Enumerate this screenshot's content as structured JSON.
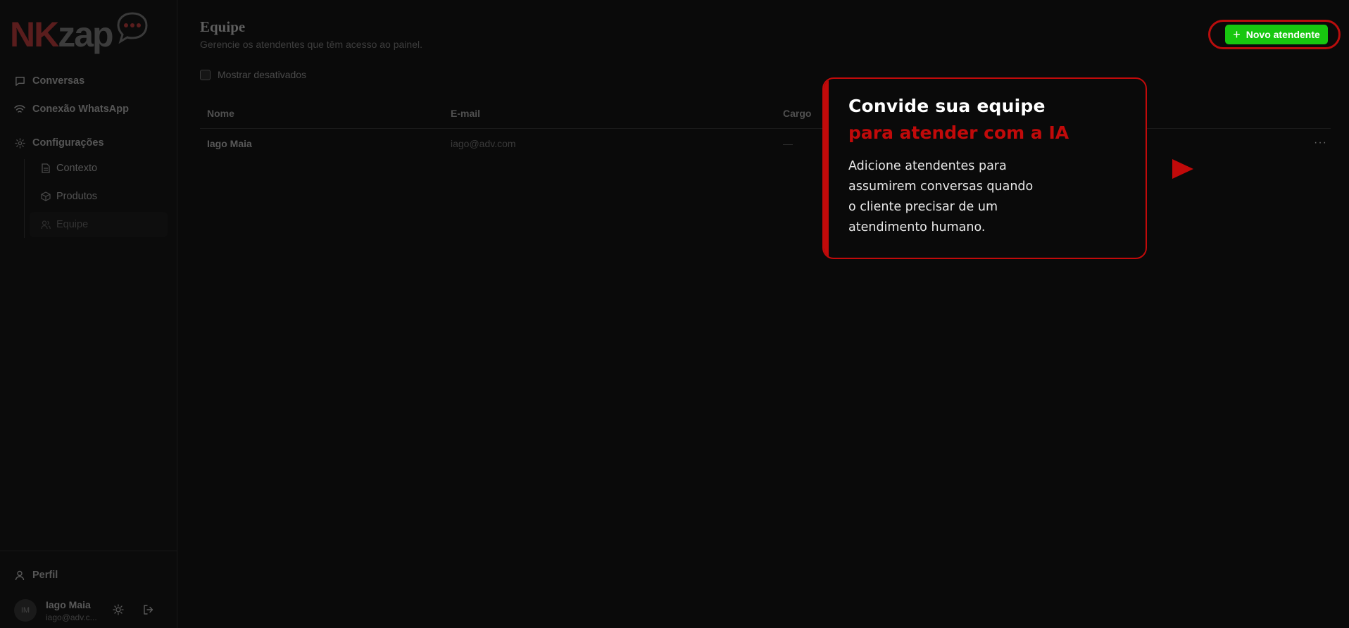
{
  "brand": {
    "prefix": "NK",
    "suffix": "zap"
  },
  "sidebar": {
    "items": [
      {
        "label": "Conversas",
        "icon": "chat-bubble-icon"
      },
      {
        "label": "Conexão WhatsApp",
        "icon": "wifi-icon"
      },
      {
        "label": "Configurações",
        "icon": "gear-icon"
      }
    ],
    "sub_items": [
      {
        "label": "Contexto",
        "icon": "document-icon"
      },
      {
        "label": "Produtos",
        "icon": "box-icon"
      },
      {
        "label": "Equipe",
        "icon": "users-icon",
        "active": true
      }
    ],
    "profile_label": "Perfil",
    "user": {
      "initials": "IM",
      "name": "Iago Maia",
      "email": "iago@adv.c..."
    }
  },
  "header": {
    "title": "Equipe",
    "subtitle": "Gerencie os atendentes que têm acesso ao painel.",
    "new_button_label": "Novo atendente"
  },
  "filter": {
    "show_disabled_label": "Mostrar desativados",
    "checked": false
  },
  "table": {
    "columns": [
      "Nome",
      "E-mail",
      "Cargo"
    ],
    "rows": [
      {
        "name": "Iago Maia",
        "email": "iago@adv.com",
        "cargo": "—"
      }
    ]
  },
  "tooltip": {
    "title_line1": "Convide sua equipe",
    "title_line2": "para atender com a IA",
    "body_lines": [
      "Adicione atendentes para",
      "assumirem conversas quando",
      "o cliente precisar de um",
      "atendimento humano."
    ]
  },
  "colors": {
    "accent_red": "#c10a0a",
    "button_green": "#17c70f",
    "background": "#0a0a0a"
  }
}
